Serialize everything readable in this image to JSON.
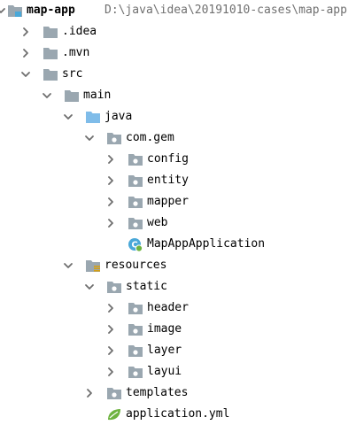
{
  "colors": {
    "folder": "#9aa7b0",
    "source_folder": "#7fbce9",
    "module_blue": "#4aa8d8",
    "resources_stripes": "#d4a017",
    "spring_green": "#6db33f",
    "arrow": "#6e6e6e",
    "path_text": "#707070"
  },
  "tree": [
    {
      "label": "map-app",
      "path": "D:\\java\\idea\\20191010-cases\\map-app",
      "icon": "module-folder-icon",
      "state": "expanded",
      "depth": 0
    },
    {
      "label": ".idea",
      "icon": "folder-icon",
      "state": "collapsed",
      "depth": 1
    },
    {
      "label": ".mvn",
      "icon": "folder-icon",
      "state": "collapsed",
      "depth": 1
    },
    {
      "label": "src",
      "icon": "folder-icon",
      "state": "expanded",
      "depth": 1
    },
    {
      "label": "main",
      "icon": "folder-icon",
      "state": "expanded",
      "depth": 2
    },
    {
      "label": "java",
      "icon": "source-folder-icon",
      "state": "expanded",
      "depth": 3
    },
    {
      "label": "com.gem",
      "icon": "package-icon",
      "state": "expanded",
      "depth": 4
    },
    {
      "label": "config",
      "icon": "package-icon",
      "state": "collapsed",
      "depth": 5
    },
    {
      "label": "entity",
      "icon": "package-icon",
      "state": "collapsed",
      "depth": 5
    },
    {
      "label": "mapper",
      "icon": "package-icon",
      "state": "collapsed",
      "depth": 5
    },
    {
      "label": "web",
      "icon": "package-icon",
      "state": "collapsed",
      "depth": 5
    },
    {
      "label": "MapAppApplication",
      "icon": "spring-boot-class-icon",
      "state": "none",
      "depth": 5
    },
    {
      "label": "resources",
      "icon": "resources-folder-icon",
      "state": "expanded",
      "depth": 3
    },
    {
      "label": "static",
      "icon": "package-icon",
      "state": "expanded",
      "depth": 4
    },
    {
      "label": "header",
      "icon": "package-icon",
      "state": "collapsed",
      "depth": 5
    },
    {
      "label": "image",
      "icon": "package-icon",
      "state": "collapsed",
      "depth": 5
    },
    {
      "label": "layer",
      "icon": "package-icon",
      "state": "collapsed",
      "depth": 5
    },
    {
      "label": "layui",
      "icon": "package-icon",
      "state": "collapsed",
      "depth": 5
    },
    {
      "label": "templates",
      "icon": "package-icon",
      "state": "collapsed",
      "depth": 4
    },
    {
      "label": "application.yml",
      "icon": "spring-config-icon",
      "state": "none",
      "depth": 4
    }
  ]
}
